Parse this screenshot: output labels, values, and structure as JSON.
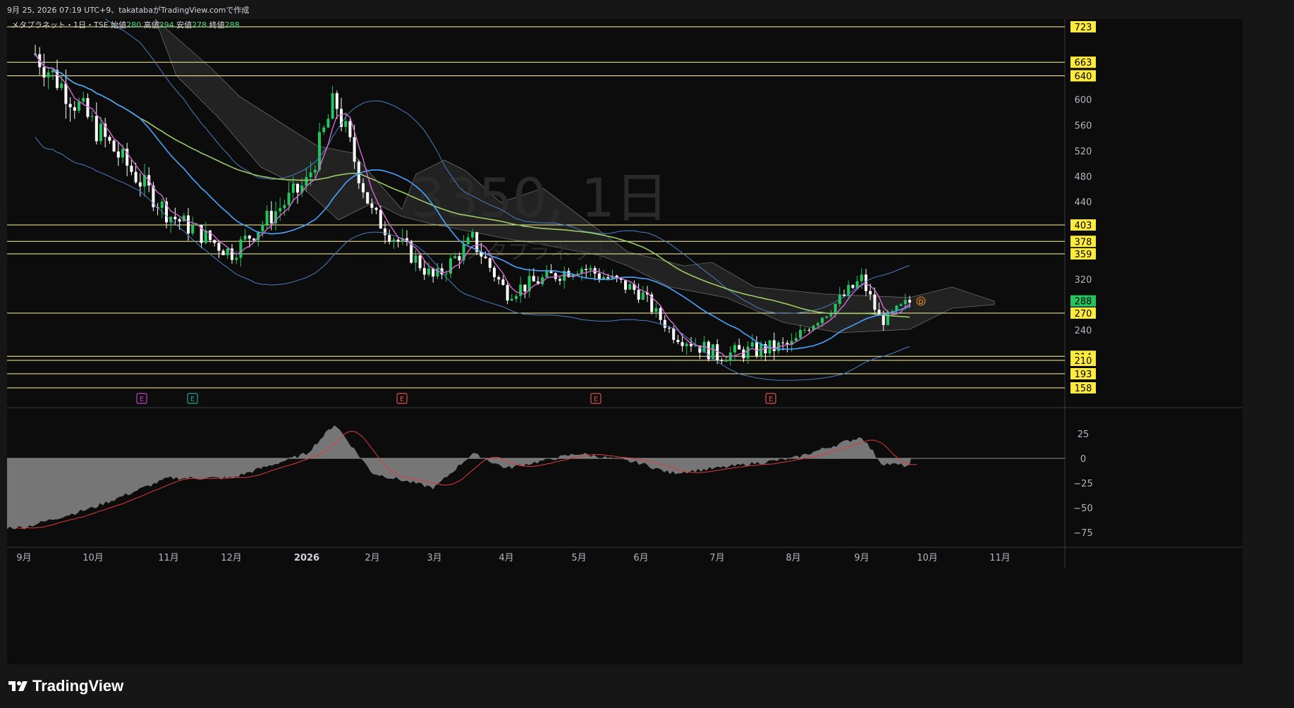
{
  "header": {
    "created_text": "9月 25, 2026 07:19 UTC+9、takatabaがTradingView.comで作成"
  },
  "legend": {
    "symbol": "メタプラネット・1日・TSE",
    "open_label": "始値",
    "open_value": "280",
    "high_label": "高値",
    "high_value": "294",
    "low_label": "安値",
    "low_value": "278",
    "close_label": "終値",
    "close_value": "288"
  },
  "watermark": {
    "title": "3350, 1日",
    "subtitle": "メタプラネット"
  },
  "footer": {
    "brand": "TradingView"
  },
  "colors": {
    "background": "#0c0c0c",
    "grid": "#1c1c1c",
    "up": "#22c55e",
    "down": "#ffffff",
    "level_line": "#fff59d",
    "level_badge": "#ffeb3b",
    "last_price_badge": "#22c55e",
    "bollinger": "#4a7fc1",
    "ma_short": "#d36ad1",
    "ma_mid": "#4aa3ff",
    "ma_long": "#9ccc65",
    "cloud": "#2a2a2a",
    "macd_hist": "#8a8a8a",
    "macd_signal": "#e23b3b"
  },
  "chart_data": [
    {
      "type": "candlestick",
      "title": "3350, 1日",
      "y_axis_ticks": [
        600,
        560,
        520,
        480,
        440,
        320,
        240
      ],
      "ylim": [
        140,
        740
      ],
      "x_ticks": [
        "9月",
        "10月",
        "11月",
        "12月",
        "2026",
        "2月",
        "3月",
        "4月",
        "5月",
        "6月",
        "7月",
        "8月",
        "9月",
        "10月",
        "11月"
      ],
      "last_price": 288,
      "ohlc": {
        "open": 280,
        "high": 294,
        "low": 278,
        "close": 288
      },
      "horizontal_levels": [
        723,
        663,
        640,
        403,
        378,
        359,
        270,
        214,
        210,
        193,
        158
      ],
      "price_path": [
        [
          "9月",
          700
        ],
        [
          "10月",
          560
        ],
        [
          "11月",
          420
        ],
        [
          "12月",
          360
        ],
        [
          "2026",
          470
        ],
        [
          "2026b",
          600
        ],
        [
          "2月",
          420
        ],
        [
          "3月",
          320
        ],
        [
          "3月b",
          380
        ],
        [
          "4月",
          300
        ],
        [
          "5月",
          340
        ],
        [
          "6月",
          300
        ],
        [
          "6月b",
          240
        ],
        [
          "7月",
          215
        ],
        [
          "8月",
          225
        ],
        [
          "9月",
          320
        ],
        [
          "9月b",
          255
        ],
        [
          "9月c",
          288
        ]
      ],
      "earnings_markers": [
        "12月",
        "2月",
        "5月",
        "8月",
        "11月"
      ],
      "indicators": [
        "Bollinger Bands",
        "Ichimoku Cloud",
        "Moving Averages"
      ]
    },
    {
      "type": "area",
      "title": "",
      "y_axis_ticks": [
        25,
        0,
        -25,
        -50,
        -75
      ],
      "ylim": [
        -90,
        40
      ],
      "histogram_path": [
        [
          "9月",
          -70
        ],
        [
          "10月",
          -50
        ],
        [
          "11月",
          -20
        ],
        [
          "12月",
          -20
        ],
        [
          "2026",
          5
        ],
        [
          "2026b",
          35
        ],
        [
          "2月",
          -15
        ],
        [
          "3月",
          -30
        ],
        [
          "3月b",
          5
        ],
        [
          "4月",
          -10
        ],
        [
          "5月",
          5
        ],
        [
          "6月",
          -5
        ],
        [
          "6月b",
          -15
        ],
        [
          "7月",
          -10
        ],
        [
          "8月",
          0
        ],
        [
          "9月",
          22
        ],
        [
          "9月b",
          -5
        ],
        [
          "9月c",
          -8
        ]
      ]
    }
  ]
}
